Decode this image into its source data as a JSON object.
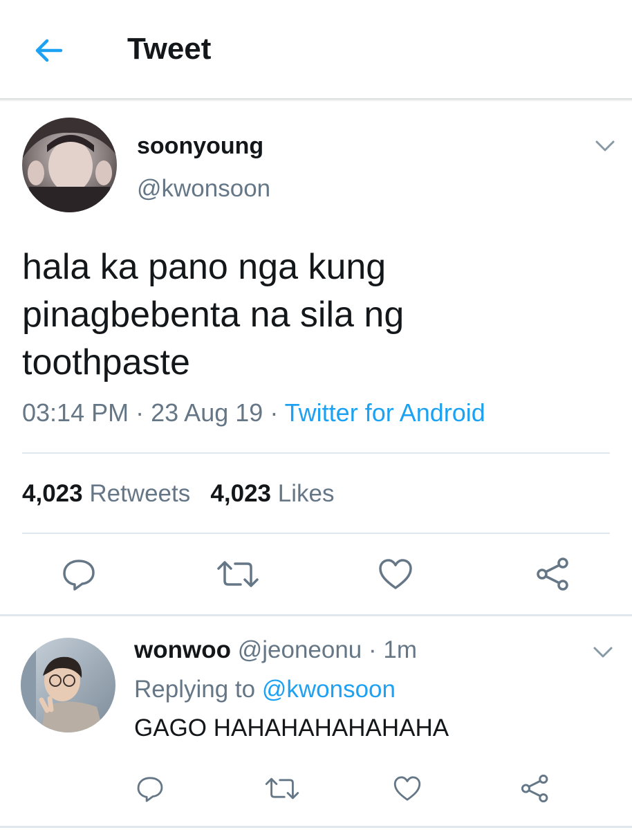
{
  "header": {
    "title": "Tweet"
  },
  "tweet": {
    "display_name": "soonyoung",
    "handle": "@kwonsoon",
    "text_lines": [
      "hala ka pano nga kung",
      "pinagbebenta na sila ng",
      "toothpaste"
    ],
    "time": "03:14 PM",
    "date": "23 Aug 19",
    "source": "Twitter for Android",
    "retweets_count": "4,023",
    "retweets_label": "Retweets",
    "likes_count": "4,023",
    "likes_label": "Likes"
  },
  "reply": {
    "display_name": "wonwoo",
    "handle": "@jeoneonu",
    "time": "1m",
    "replying_prefix": "Replying to",
    "replying_to": "@kwonsoon",
    "text": "GAGO HAHAHAHAHAHAHA"
  },
  "separator": "·",
  "icons": {
    "back": "arrow-left-icon",
    "caret": "chevron-down-icon",
    "reply": "comment-icon",
    "retweet": "retweet-icon",
    "like": "heart-icon",
    "share": "share-icon"
  },
  "colors": {
    "accent": "#1da1f2",
    "secondary_text": "#657786",
    "primary_text": "#14171a",
    "divider": "#e1e8ed",
    "icon": "#657786"
  }
}
